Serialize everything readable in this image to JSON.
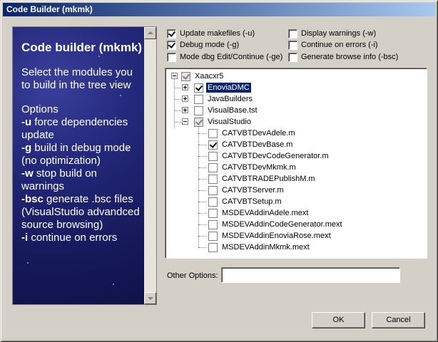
{
  "window": {
    "title": "Code Builder (mkmk)"
  },
  "side_panel": {
    "title": "Code builder (mkmk)",
    "intro": "Select the modules you to build in the tree view",
    "options_heading": "Options",
    "options": [
      {
        "flag": "-u",
        "text": " force dependencies update"
      },
      {
        "flag": "-g",
        "text": " build in debug mode (no optimization)"
      },
      {
        "flag": "-w",
        "text": " stop build on warnings"
      },
      {
        "flag": "-bsc",
        "text": " generate .bsc files (VisualStudio advandced source browsing)"
      },
      {
        "flag": "-i",
        "text": " continue on errors"
      }
    ]
  },
  "checkboxes": [
    {
      "label": "Update makefiles (-u)",
      "checked": true
    },
    {
      "label": "Debug mode (-g)",
      "checked": true
    },
    {
      "label": "Mode dbg Edit/Continue (-ge)",
      "checked": false
    },
    {
      "label": "Display warnings (-w)",
      "checked": false
    },
    {
      "label": "Continue on errors (-i)",
      "checked": false
    },
    {
      "label": "Generate browse info (-bsc)",
      "checked": false
    }
  ],
  "tree": {
    "root": {
      "label": "Xaacxr5",
      "checked": true,
      "grayed": true
    },
    "children": [
      {
        "label": "EnoviaDMC",
        "checked": true,
        "selected": true
      },
      {
        "label": "JavaBuilders",
        "checked": false
      },
      {
        "label": "VisualBase.tst",
        "checked": false
      },
      {
        "label": "VisualStudio",
        "checked": true,
        "grayed": true
      }
    ],
    "visualstudio_items": [
      {
        "label": "CATVBTDevAdele.m",
        "checked": false
      },
      {
        "label": "CATVBTDevBase.m",
        "checked": true
      },
      {
        "label": "CATVBTDevCodeGenerator.m",
        "checked": false
      },
      {
        "label": "CATVBTDevMkmk.m",
        "checked": false
      },
      {
        "label": "CATVBTRADEPublishM.m",
        "checked": false
      },
      {
        "label": "CATVBTServer.m",
        "checked": false
      },
      {
        "label": "CATVBTSetup.m",
        "checked": false
      },
      {
        "label": "MSDEVAddinAdele.mext",
        "checked": false
      },
      {
        "label": "MSDEVAddinCodeGenerator.mext",
        "checked": false
      },
      {
        "label": "MSDEVAddinEnoviaRose.mext",
        "checked": false
      },
      {
        "label": "MSDEVAddinMkmk.mext",
        "checked": false
      }
    ]
  },
  "other_options": {
    "label": "Other Options:",
    "value": ""
  },
  "buttons": {
    "ok": "OK",
    "cancel": "Cancel"
  }
}
